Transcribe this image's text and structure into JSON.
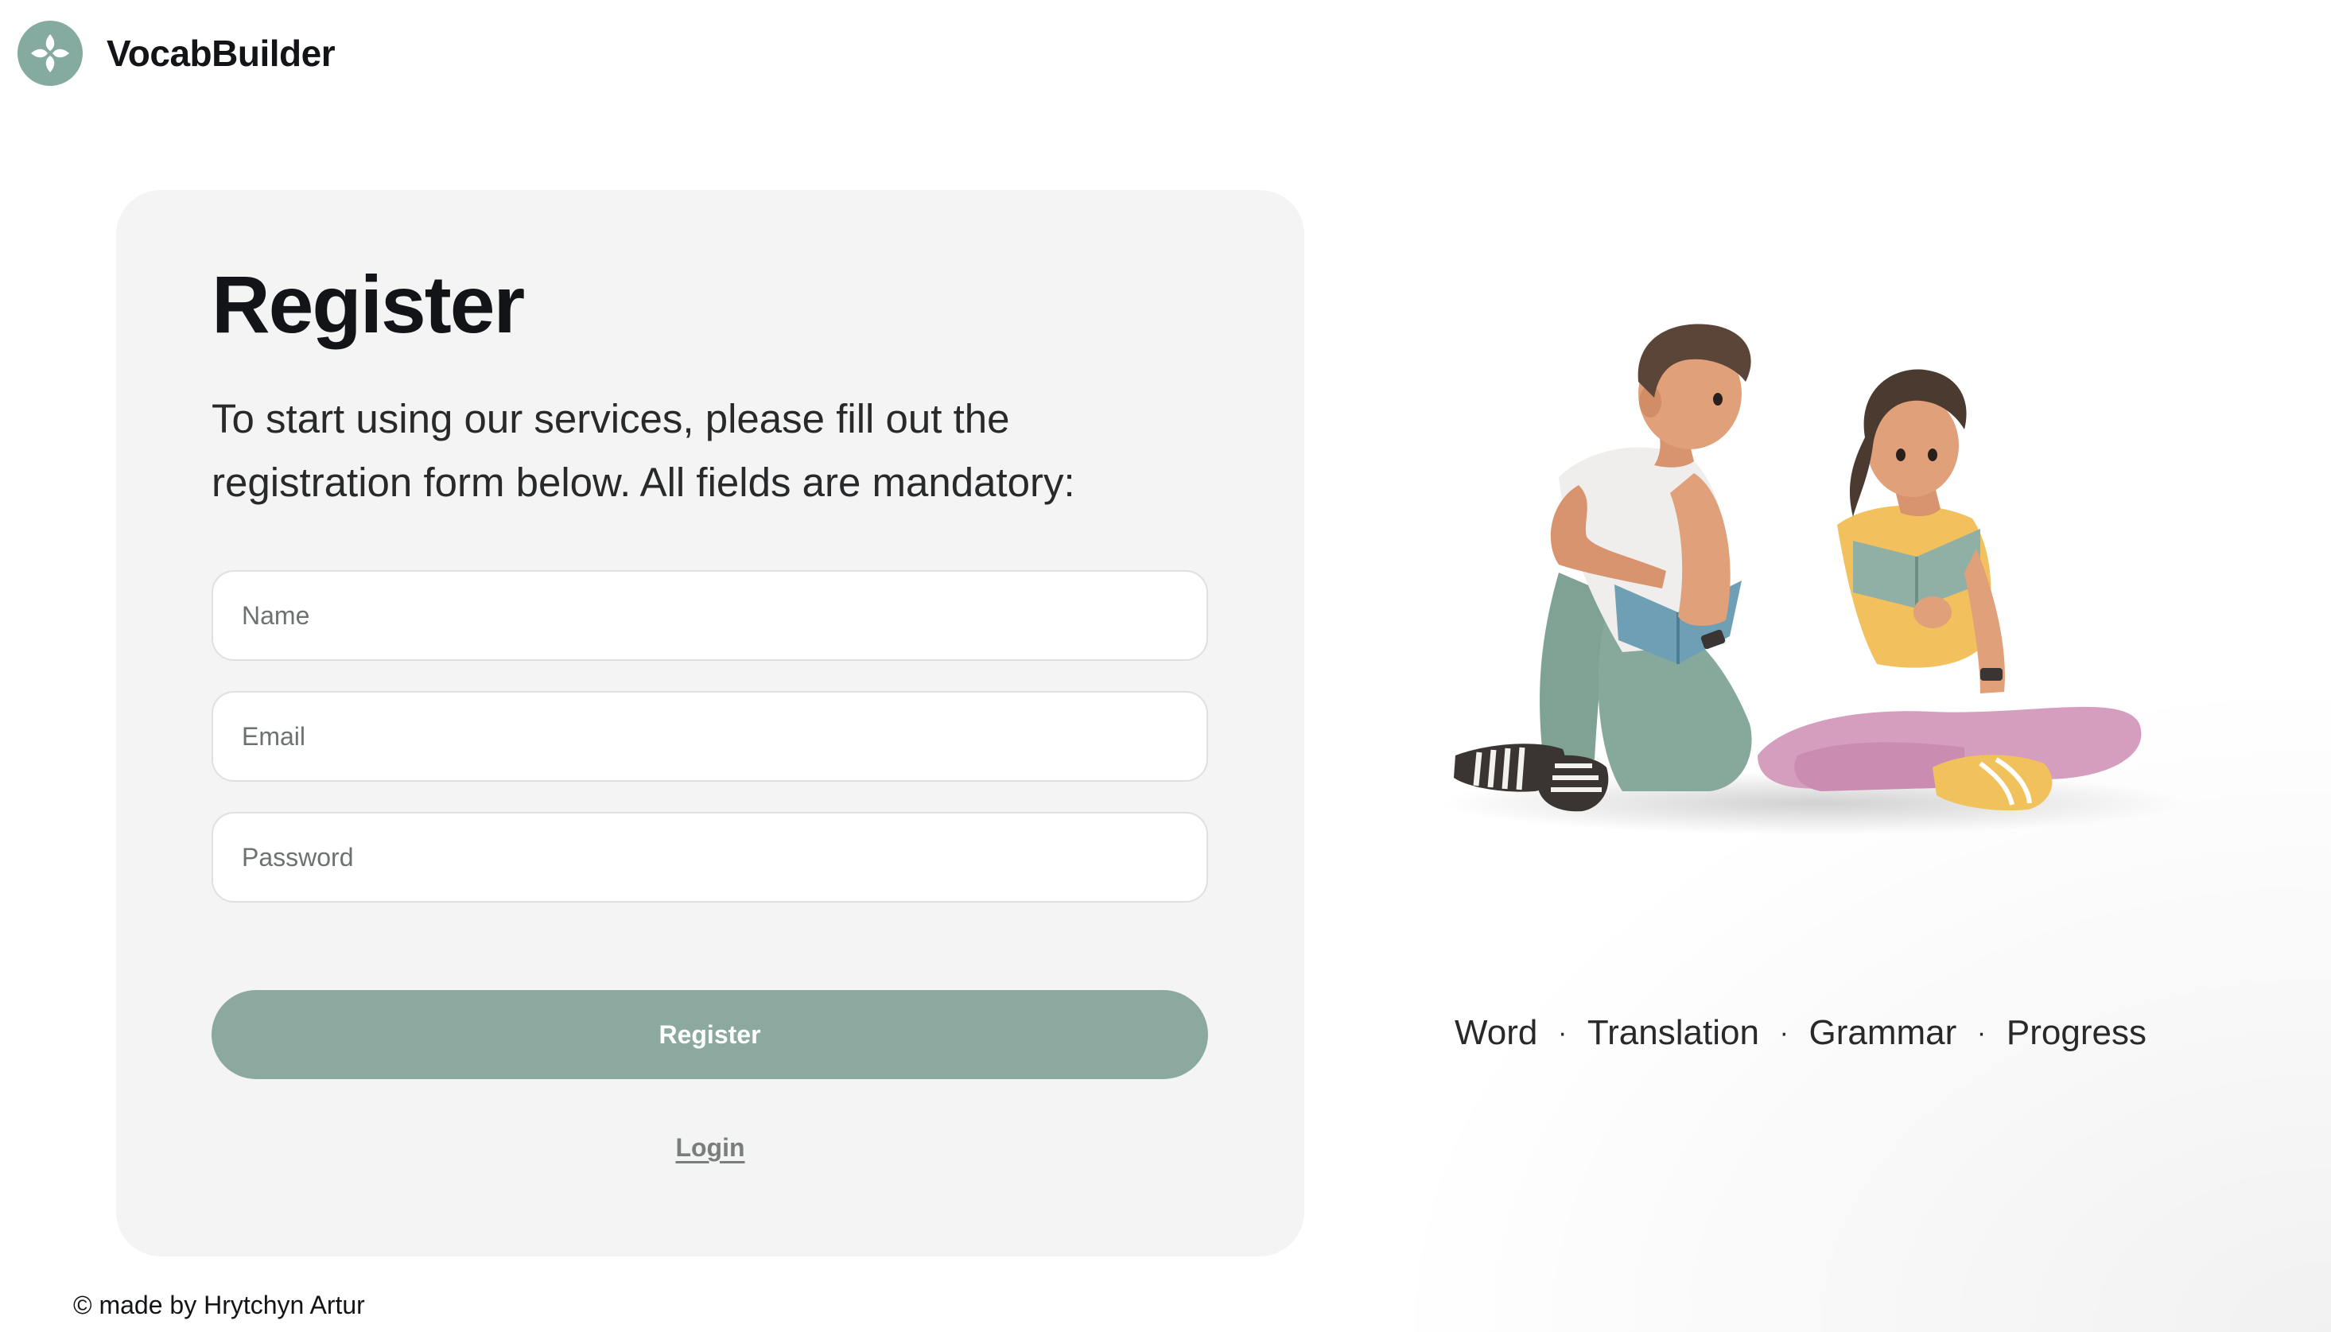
{
  "app": {
    "name": "VocabBuilder",
    "logo_icon": "four-petal-logo-icon",
    "accent_color": "#85aa9f"
  },
  "form": {
    "title": "Register",
    "description": "To start using our services, please fill out the registration form below. All fields are mandatory:",
    "name_placeholder": "Name",
    "email_placeholder": "Email",
    "password_placeholder": "Password",
    "submit_label": "Register",
    "login_label": "Login",
    "button_color": "#8ba99e"
  },
  "features": {
    "items": [
      "Word",
      "Translation",
      "Grammar",
      "Progress"
    ],
    "separator": "·"
  },
  "illustration": {
    "icon": "two-people-reading-books-illustration"
  },
  "footer": {
    "text": "© made by Hrytchyn Artur"
  }
}
